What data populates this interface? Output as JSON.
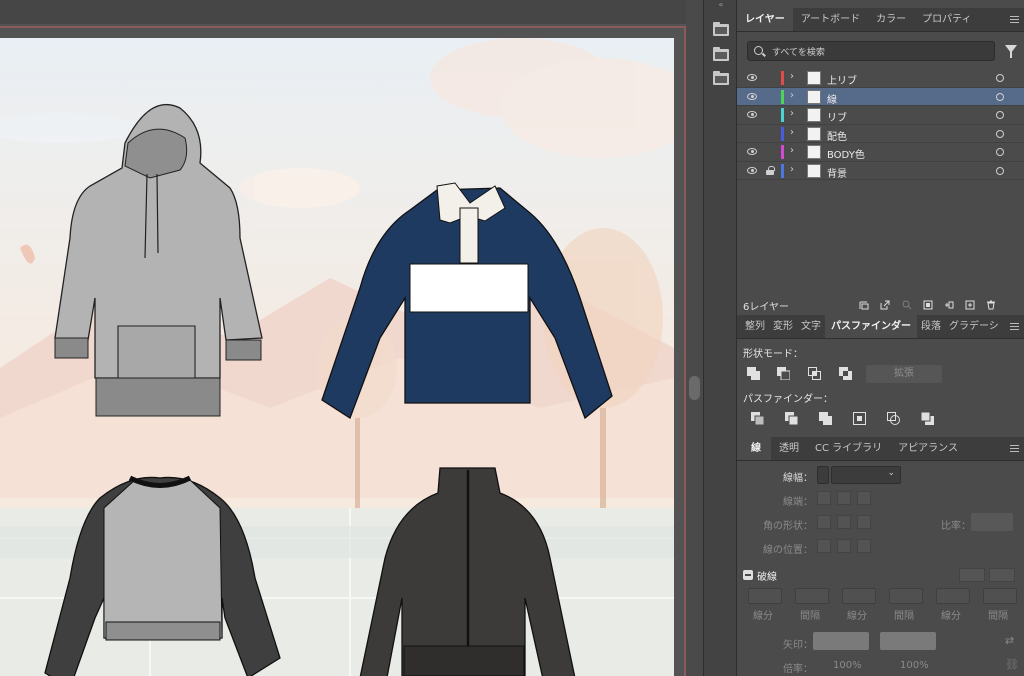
{
  "layers_panel": {
    "tabs": [
      "レイヤー",
      "アートボード",
      "カラー",
      "プロパティ"
    ],
    "active_tab": "レイヤー",
    "search_placeholder": "すべてを検索",
    "layers": [
      {
        "name": "上リブ",
        "visible": true,
        "locked": false,
        "color": "#e04b4b",
        "selected": false
      },
      {
        "name": "線",
        "visible": true,
        "locked": false,
        "color": "#4bd35a",
        "selected": true
      },
      {
        "name": "リブ",
        "visible": true,
        "locked": false,
        "color": "#4bd3d3",
        "selected": false
      },
      {
        "name": "配色",
        "visible": false,
        "locked": false,
        "color": "#4b5be0",
        "selected": false
      },
      {
        "name": "BODY色",
        "visible": true,
        "locked": false,
        "color": "#d24bd3",
        "selected": false
      },
      {
        "name": "背景",
        "visible": true,
        "locked": true,
        "color": "#4b78e0",
        "selected": false
      }
    ],
    "layer_count": "6レイヤー"
  },
  "pathfinder_panel": {
    "tabs": [
      "整列",
      "変形",
      "文字",
      "パスファインダー",
      "段落",
      "グラデーシ"
    ],
    "active_tab": "パスファインダー",
    "shape_modes_label": "形状モード：",
    "expand_button": "拡張",
    "pathfinders_label": "パスファインダー："
  },
  "stroke_panel": {
    "tabs": [
      "線",
      "透明",
      "CC ライブラリ",
      "アピアランス"
    ],
    "active_tab": "線",
    "weight_label": "線幅：",
    "cap_label": "線端：",
    "corner_label": "角の形状：",
    "limit_label": "比率：",
    "align_label": "線の位置：",
    "dashed_label": "破線",
    "dash_labels": [
      "線分",
      "間隔",
      "線分",
      "間隔",
      "線分",
      "間隔"
    ],
    "arrowheads_label": "矢印：",
    "scale_label": "倍率：",
    "scale_values": [
      "100%",
      "100%"
    ]
  },
  "colors": {
    "panel_bg": "#4b4b4b",
    "selected_row": "#566a8a",
    "navy_shirt": "#1f3a60",
    "grey_hoodie": "#b3b3b3",
    "dark_jacket": "#3d3b3a"
  }
}
